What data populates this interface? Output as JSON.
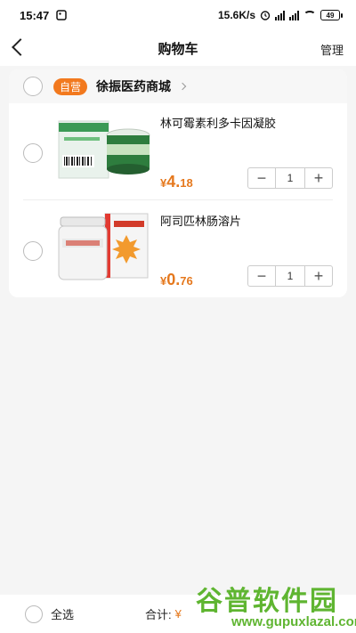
{
  "statusbar": {
    "time": "15:47",
    "speed": "15.6K/s",
    "battery": "49"
  },
  "navbar": {
    "title": "购物车",
    "manage": "管理"
  },
  "store": {
    "badge": "自营",
    "name": "徐振医药商城"
  },
  "items": [
    {
      "name": "林可霉素利多卡因凝胶",
      "currency": "¥",
      "price_int": "4.",
      "price_dec": "18",
      "qty": "1"
    },
    {
      "name": "阿司匹林肠溶片",
      "currency": "¥",
      "price_int": "0.",
      "price_dec": "76",
      "qty": "1"
    }
  ],
  "bottom": {
    "select_all": "全选",
    "total_label": "合计:",
    "total_symbol": "¥"
  },
  "watermark": {
    "title": "谷普软件园",
    "url": "www.gupuxlazal.com"
  },
  "colors": {
    "accent": "#e5781d",
    "badge": "#f2791e",
    "watermark": "#5fb531"
  }
}
